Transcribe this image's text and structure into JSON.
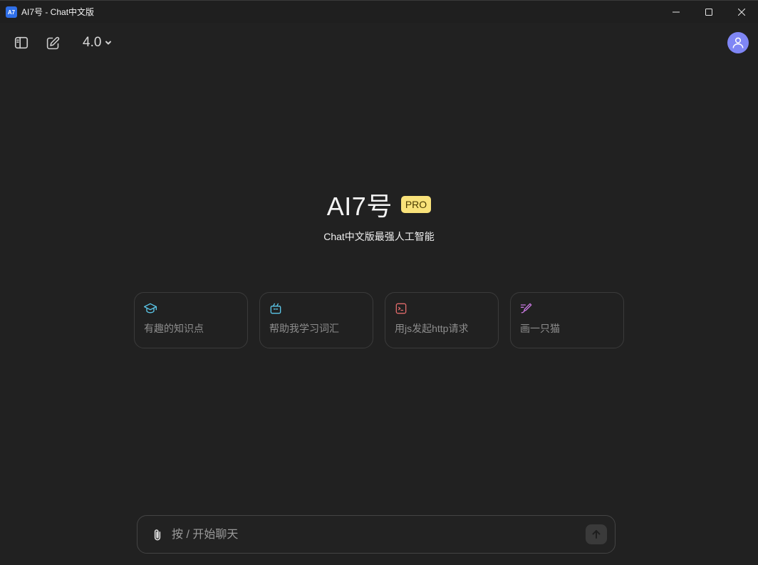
{
  "window": {
    "icon_text": "A7",
    "title": "AI7号 - Chat中文版",
    "icons": {
      "minimize": "minimize-icon",
      "maximize": "maximize-icon",
      "close": "close-icon"
    }
  },
  "toolbar": {
    "sidebar_icon": "sidebar-toggle-icon",
    "new_chat_icon": "edit-icon",
    "model_label": "4.0",
    "model_icon": "chevron-down-icon",
    "avatar_icon": "user-icon"
  },
  "hero": {
    "title": "AI7号",
    "badge": "PRO",
    "subtitle": "Chat中文版最强人工智能"
  },
  "suggestions": [
    {
      "label": "有趣的知识点",
      "icon": "graduation-cap-icon",
      "color": "#5bc6e8"
    },
    {
      "label": "帮助我学习词汇",
      "icon": "vocabulary-box-icon",
      "color": "#5bc6e8"
    },
    {
      "label": "用js发起http请求",
      "icon": "terminal-icon",
      "color": "#e06a6a"
    },
    {
      "label": "画一只猫",
      "icon": "paintbrush-icon",
      "color": "#c879e0"
    }
  ],
  "composer": {
    "placeholder": "按 / 开始聊天",
    "value": "",
    "attach_icon": "paperclip-icon",
    "send_icon": "arrow-up-icon"
  },
  "colors": {
    "background": "#212121",
    "badge": "#f9e27a",
    "avatar": "#7f86f5"
  }
}
